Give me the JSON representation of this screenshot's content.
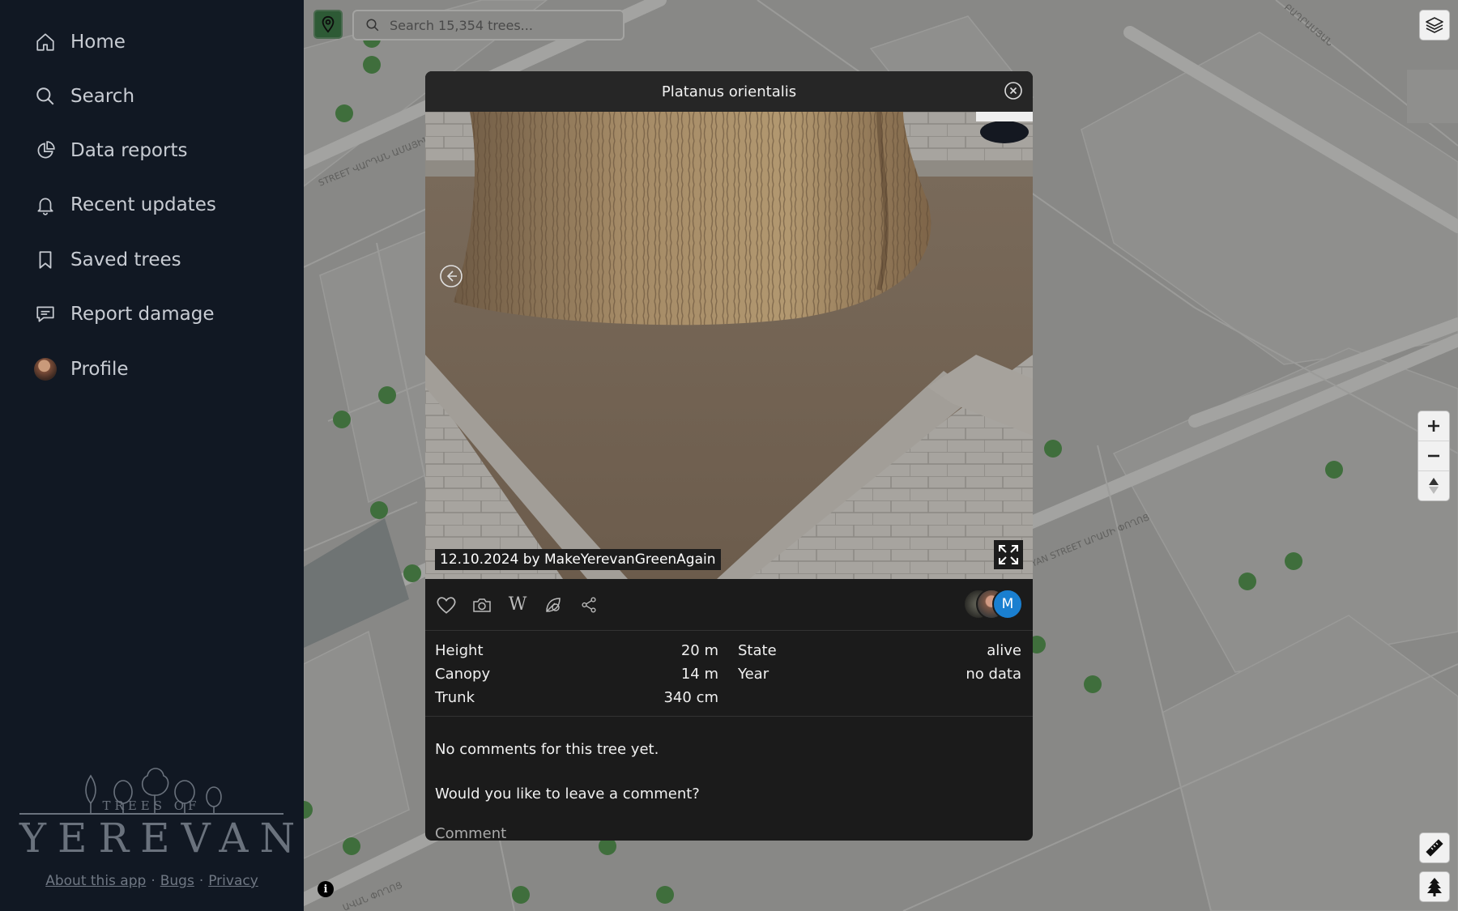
{
  "sidebar": {
    "items": [
      {
        "label": "Home",
        "icon": "home-icon"
      },
      {
        "label": "Search",
        "icon": "search-icon"
      },
      {
        "label": "Data reports",
        "icon": "pie-chart-icon"
      },
      {
        "label": "Recent updates",
        "icon": "bell-icon"
      },
      {
        "label": "Saved trees",
        "icon": "bookmark-icon"
      },
      {
        "label": "Report damage",
        "icon": "message-icon"
      },
      {
        "label": "Profile",
        "icon": "avatar"
      }
    ],
    "logo": {
      "top_text": "TREES OF",
      "main_text": "YEREVAN"
    },
    "footer": {
      "about": "About this app",
      "bugs": "Bugs",
      "privacy": "Privacy",
      "separator": "·"
    }
  },
  "map": {
    "search_placeholder": "Search 15,354 trees...",
    "street_labels": [
      "STREET ՎԱՐԴԱՆ ԱՄԱՅԻՆ",
      "YAN STREET ԱՐԱՄԻ ՓՈՂՈՑ",
      "ԱՎԱՆ ՓՈՂՈՑ",
      "ԲԱՂՐԱՄՅԱՆ"
    ],
    "info_label": "i"
  },
  "tree": {
    "title": "Platanus orientalis",
    "photo_caption": "12.10.2024 by MakeYerevanGreenAgain",
    "properties_left": [
      {
        "label": "Height",
        "value": "20 m"
      },
      {
        "label": "Canopy",
        "value": "14 m"
      },
      {
        "label": "Trunk",
        "value": "340 cm"
      }
    ],
    "properties_right": [
      {
        "label": "State",
        "value": "alive"
      },
      {
        "label": "Year",
        "value": "no data"
      }
    ],
    "contributor_initial": "M",
    "comments_empty": "No comments for this tree yet.",
    "comments_prompt": "Would you like to leave a comment?",
    "comment_label": "Comment"
  },
  "colors": {
    "sidebar_bg": "#111823",
    "modal_bg": "#1b1b1b",
    "tree_dot": "#3f6e3c",
    "accent_blue": "#1a7fd0"
  }
}
